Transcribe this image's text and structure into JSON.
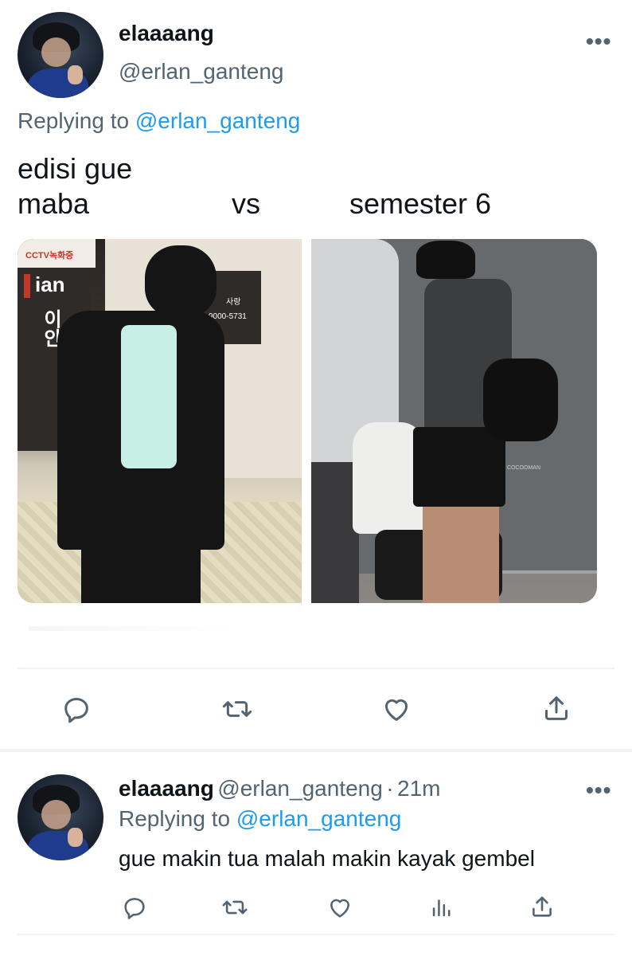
{
  "main_tweet": {
    "author": {
      "display_name": "elaaaang",
      "handle": "@erlan_ganteng"
    },
    "more_label": "•••",
    "replying": {
      "prefix": "Replying to ",
      "mention": "@erlan_ganteng"
    },
    "text_line1": "edisi gue",
    "text_line2": {
      "left": "maba",
      "middle": "vs",
      "right": "semester 6"
    },
    "photo_left": {
      "sign_cctv": "CCTV녹화중",
      "sign_ian": "ian",
      "sign_korean": "이안",
      "sign_phone": "9000-5731",
      "sign_small": "사랑"
    },
    "photo_right": {
      "watermark": "COCOOMAN"
    },
    "actions": [
      {
        "icon": "reply-icon"
      },
      {
        "icon": "retweet-icon"
      },
      {
        "icon": "like-icon"
      },
      {
        "icon": "share-icon"
      }
    ]
  },
  "reply_tweet": {
    "author": {
      "display_name": "elaaaang",
      "handle": "@erlan_ganteng",
      "separator": "·",
      "time": "21m"
    },
    "more_label": "•••",
    "replying": {
      "prefix": "Replying to ",
      "mention": "@erlan_ganteng"
    },
    "text": "gue makin tua malah makin kayak gembel",
    "actions": [
      {
        "icon": "reply-icon"
      },
      {
        "icon": "retweet-icon"
      },
      {
        "icon": "like-icon"
      },
      {
        "icon": "analytics-icon"
      },
      {
        "icon": "share-icon"
      }
    ]
  },
  "colors": {
    "text_primary": "#0f1419",
    "text_secondary": "#536471",
    "accent": "#1d9bf0",
    "divider": "#eff3f4"
  }
}
